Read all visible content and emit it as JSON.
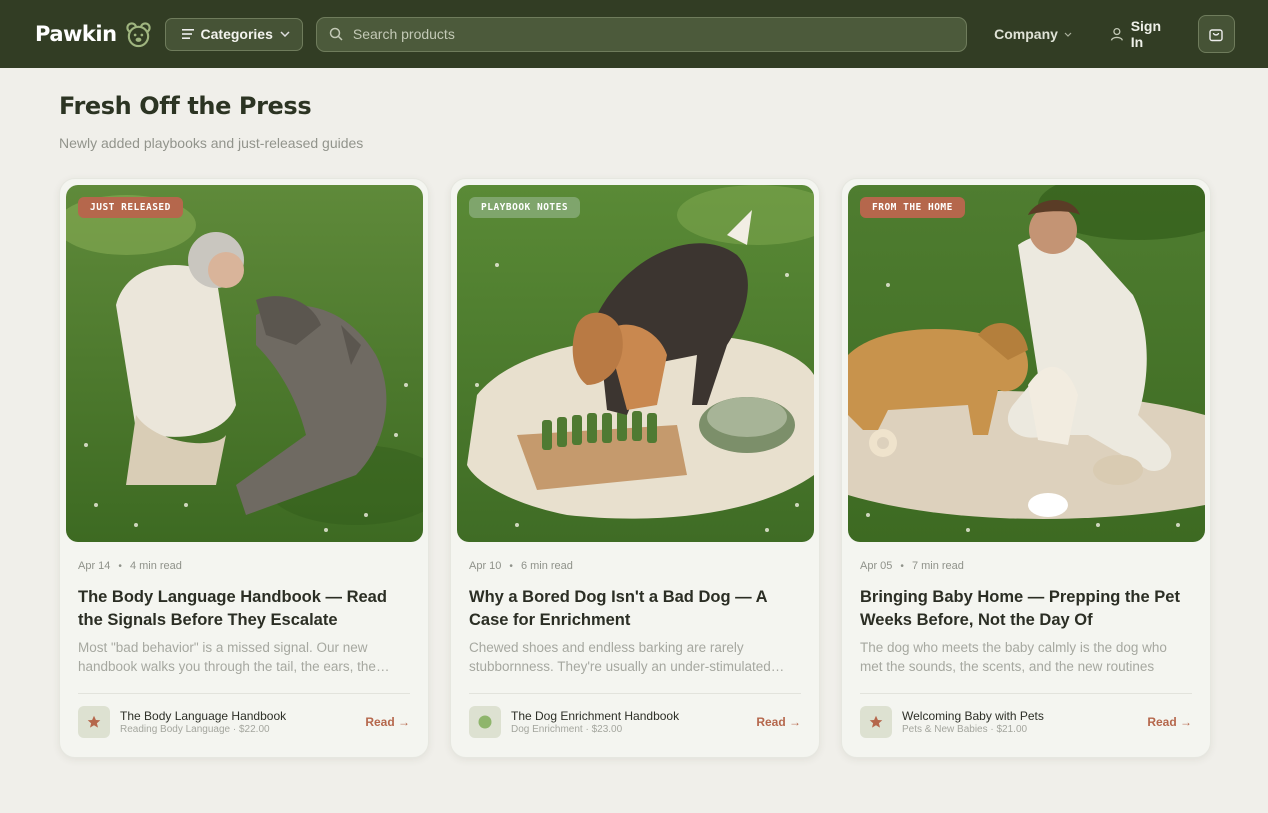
{
  "header": {
    "brand": "Pawkin",
    "categories_label": "Categories",
    "search_placeholder": "Search products",
    "company_label": "Company",
    "signin_label": "Sign In"
  },
  "section": {
    "title": "Fresh Off the Press",
    "subtitle": "Newly added playbooks and just-released guides"
  },
  "cards": [
    {
      "badge": "JUST RELEASED",
      "badge_color": "#b5674c",
      "date": "Apr 14",
      "read_time": "4 min read",
      "title": "The Body Language Handbook — Read the Signals Before They Escalate",
      "excerpt": "Most \"bad behavior\" is a missed signal. Our new handbook walks you through the tail, the ears, the…",
      "product_icon": "star-icon",
      "product_name": "The Body Language Handbook",
      "product_sub": "Reading Body Language · $22.00",
      "read_label": "Read →"
    },
    {
      "badge": "PLAYBOOK NOTES",
      "badge_color": "#7fa56c",
      "date": "Apr 10",
      "read_time": "6 min read",
      "title": "Why a Bored Dog Isn't a Bad Dog — A Case for Enrichment",
      "excerpt": "Chewed shoes and endless barking are rarely stubbornness. They're usually an under-stimulated…",
      "product_icon": "circle-icon",
      "product_name": "The Dog Enrichment Handbook",
      "product_sub": "Dog Enrichment · $23.00",
      "read_label": "Read →"
    },
    {
      "badge": "FROM THE HOME",
      "badge_color": "#b5674c",
      "date": "Apr 05",
      "read_time": "7 min read",
      "title": "Bringing Baby Home — Prepping the Pet Weeks Before, Not the Day Of",
      "excerpt": "The dog who meets the baby calmly is the dog who met the sounds, the scents, and the new routines long…",
      "product_icon": "star-icon",
      "product_name": "Welcoming Baby with Pets",
      "product_sub": "Pets & New Babies · $21.00",
      "read_label": "Read →"
    }
  ]
}
